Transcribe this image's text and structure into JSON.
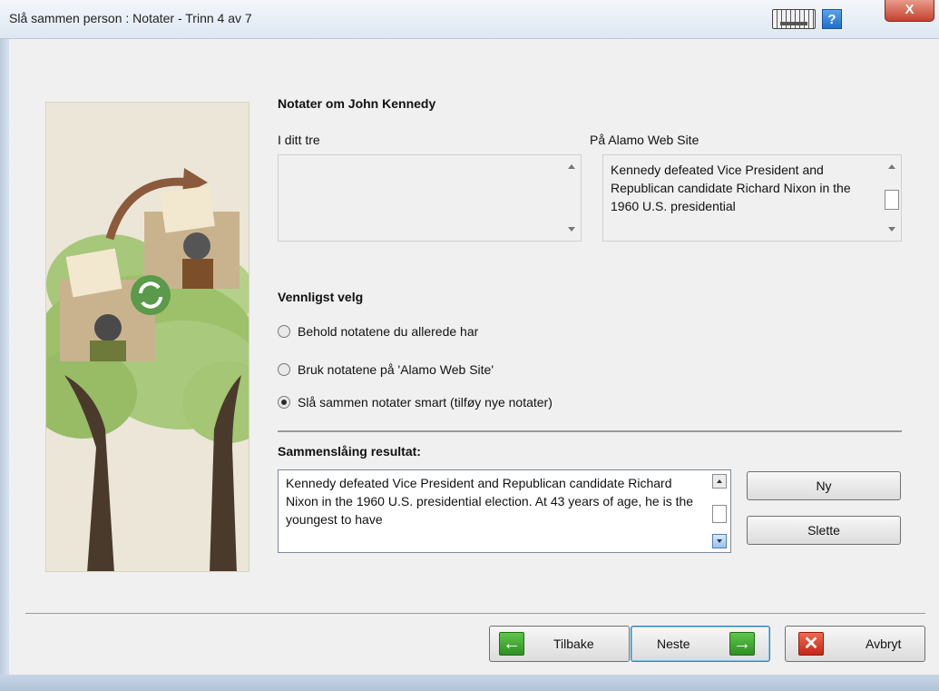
{
  "window": {
    "title": "Slå sammen person : Notater - Trinn 4 av 7",
    "help_label": "?",
    "close_label": "X"
  },
  "notes": {
    "heading": "Notater om John Kennedy",
    "left_label": "I ditt tre",
    "left_text": "",
    "right_label": "På Alamo Web Site",
    "right_text": "Kennedy defeated Vice President and Republican candidate Richard Nixon in the 1960 U.S. presidential"
  },
  "choice": {
    "heading": "Vennligst velg",
    "options": [
      {
        "label": "Behold notatene du allerede har",
        "checked": false
      },
      {
        "label": "Bruk notatene på 'Alamo Web Site'",
        "checked": false
      },
      {
        "label": "Slå sammen notater smart (tilføy nye notater)",
        "checked": true
      }
    ]
  },
  "result": {
    "heading": "Sammenslåing resultat:",
    "text": "Kennedy defeated Vice President and Republican candidate Richard Nixon in the 1960 U.S. presidential election. At 43 years of age, he is the youngest to have",
    "new_label": "Ny",
    "delete_label": "Slette"
  },
  "footer": {
    "back_label": "Tilbake",
    "next_label": "Neste",
    "cancel_label": "Avbryt"
  },
  "icons": {
    "keyboard": "keyboard-icon",
    "help": "help-icon",
    "close": "close-icon",
    "back": "arrow-left-icon",
    "next": "arrow-right-icon",
    "cancel": "x-icon"
  },
  "colors": {
    "accent_blue": "#3c7fb1",
    "green": "#2f8f23",
    "red": "#c32816"
  }
}
